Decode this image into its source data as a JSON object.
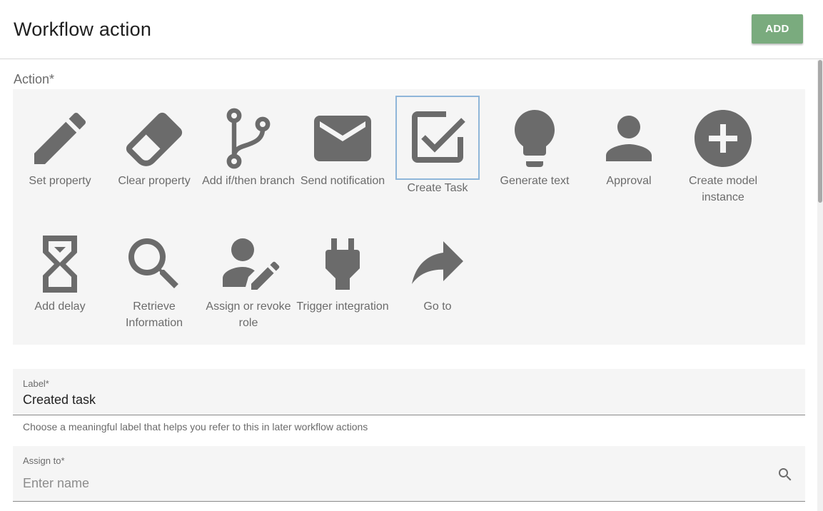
{
  "header": {
    "title": "Workflow action",
    "add_label": "ADD"
  },
  "action_section": {
    "label": "Action*",
    "selected": "Create Task",
    "items": [
      {
        "label": "Set property",
        "icon": "pencil-icon"
      },
      {
        "label": "Clear property",
        "icon": "eraser-icon"
      },
      {
        "label": "Add if/then branch",
        "icon": "branch-icon"
      },
      {
        "label": "Send notification",
        "icon": "envelope-icon"
      },
      {
        "label": "Create Task",
        "icon": "checkbox-icon"
      },
      {
        "label": "Generate text",
        "icon": "lightbulb-icon"
      },
      {
        "label": "Approval",
        "icon": "person-icon"
      },
      {
        "label": "Create model instance",
        "icon": "plus-circle-icon"
      },
      {
        "label": "Add delay",
        "icon": "hourglass-icon"
      },
      {
        "label": "Retrieve Information",
        "icon": "magnifier-icon"
      },
      {
        "label": "Assign or revoke role",
        "icon": "person-edit-icon"
      },
      {
        "label": "Trigger integration",
        "icon": "plug-icon"
      },
      {
        "label": "Go to",
        "icon": "forward-arrow-icon"
      }
    ]
  },
  "label_field": {
    "label": "Label*",
    "value": "Created task",
    "helper": "Choose a meaningful label that helps you refer to this in later workflow actions"
  },
  "assign_field": {
    "label": "Assign to*",
    "placeholder": "Enter name",
    "icon": "search-icon"
  },
  "colors": {
    "icon_gray": "#6b6b6b",
    "add_button": "#7aab7e",
    "selected_border": "#8fb6d9",
    "panel_bg": "#f5f5f5"
  }
}
